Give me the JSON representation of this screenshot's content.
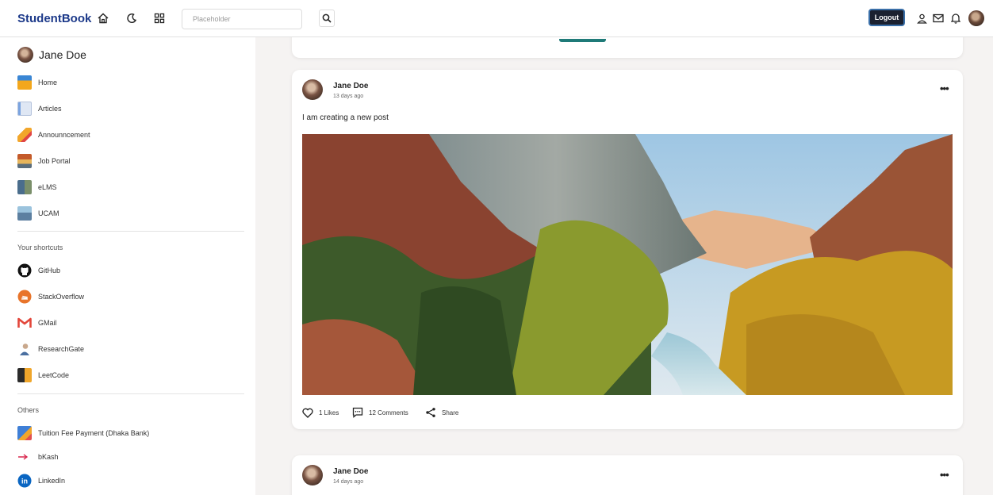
{
  "app": {
    "title": "StudentBook"
  },
  "search": {
    "placeholder": "Placeholder"
  },
  "header": {
    "logout_label": "Logout"
  },
  "user": {
    "name": "Jane Doe"
  },
  "sidebar": {
    "main_items": [
      {
        "label": "Home",
        "icon": "home-icon"
      },
      {
        "label": "Articles",
        "icon": "articles-icon"
      },
      {
        "label": "Announncement",
        "icon": "megaphone-icon"
      },
      {
        "label": "Job Portal",
        "icon": "job-portal-icon"
      },
      {
        "label": "eLMS",
        "icon": "elms-icon"
      },
      {
        "label": "UCAM",
        "icon": "ucam-icon"
      }
    ],
    "shortcuts_title": "Your shortcuts",
    "shortcuts": [
      {
        "label": "GitHub",
        "icon": "github-icon"
      },
      {
        "label": "StackOverflow",
        "icon": "stackoverflow-icon"
      },
      {
        "label": "GMail",
        "icon": "gmail-icon"
      },
      {
        "label": "ResearchGate",
        "icon": "researchgate-icon"
      },
      {
        "label": "LeetCode",
        "icon": "leetcode-icon"
      }
    ],
    "others_title": "Others",
    "others": [
      {
        "label": "Tuition Fee Payment (Dhaka Bank)",
        "icon": "payment-icon"
      },
      {
        "label": "bKash",
        "icon": "bkash-icon"
      },
      {
        "label": "LinkedIn",
        "icon": "linkedin-icon"
      }
    ]
  },
  "posts": [
    {
      "author": "Jane Doe",
      "time": "13 days ago",
      "text": "I am creating a new post",
      "likes": "1 Likes",
      "comments": "12 Comments",
      "share": "Share"
    },
    {
      "author": "Jane Doe",
      "time": "14 days ago"
    }
  ],
  "colors": {
    "brand": "#1d3a8a",
    "logout_bg": "#1b2130",
    "accent_teal": "#1f7a78"
  }
}
